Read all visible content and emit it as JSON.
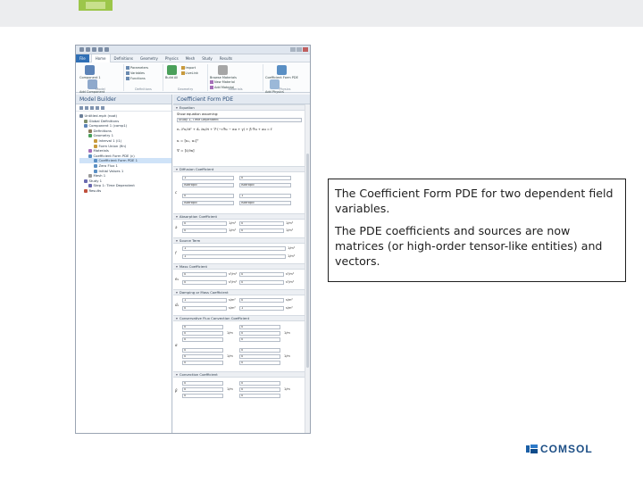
{
  "callout": {
    "paragraph1": "The Coefficient Form PDE for two dependent field variables.",
    "paragraph2": "The PDE coefficients and sources are now matrices (or high-order tensor-like entities) and vectors."
  },
  "brand": {
    "name": "COMSOL"
  },
  "app": {
    "ribbon_tabs": [
      "File",
      "Home",
      "Definitions",
      "Geometry",
      "Physics",
      "Mesh",
      "Study",
      "Results"
    ],
    "ribbon_groups": {
      "model": {
        "label": "Model",
        "buttons": [
          "Component 1",
          "Add Component"
        ]
      },
      "definitions": {
        "label": "Definitions",
        "items": [
          "Parameters",
          "Variables",
          "Functions"
        ]
      },
      "geometry": {
        "label": "Geometry",
        "items": [
          "Import",
          "LiveLink"
        ],
        "button": "Build All"
      },
      "materials": {
        "label": "Materials",
        "items": [
          "New Material",
          "Add Material"
        ],
        "button": "Browse Materials"
      },
      "physics": {
        "label": "Physics",
        "buttons": [
          "Coefficient Form PDE",
          "Add Physics"
        ]
      }
    },
    "builder": {
      "title": "Model Builder",
      "tree": [
        "Untitled.mph (root)",
        "Global Definitions",
        "Component 1 (comp1)",
        "Definitions",
        "Geometry 1",
        "Interval 1 (i1)",
        "Form Union (fin)",
        "Materials",
        "Coefficient Form PDE (c)",
        "Coefficient Form PDE 1",
        "Zero Flux 1",
        "Initial Values 1",
        "Mesh 1",
        "Study 1",
        "Step 1: Time Dependent",
        "Results"
      ]
    },
    "settings": {
      "title": "Coefficient Form PDE",
      "sections": {
        "equation": "Equation",
        "equation_label": "Show equation assuming:",
        "equation_select": "Study 1, Time Dependent",
        "eq_main": "eₐ ∂²u/∂t² + dₐ ∂u/∂t + ∇·(−c∇u − αu + γ) + β·∇u + au = f",
        "eq_u": "u = [u₁, u₂]ᵀ",
        "eq_nabla": "∇ = [∂/∂x]",
        "diffusion": "Diffusion Coefficient",
        "absorption": "Absorption Coefficient",
        "source": "Source Term",
        "mass": "Mass Coefficient",
        "damping": "Damping or Mass Coefficient",
        "conservative_flux": "Conservative Flux Convection Coefficient",
        "convection": "Convection Coefficient"
      },
      "symbols": {
        "c": "c",
        "a": "a",
        "f": "f",
        "ea": "eₐ",
        "da": "dₐ",
        "alpha": "α",
        "beta": "β"
      },
      "values": {
        "one": "1",
        "zero": "0",
        "isotropic": "Isotropic"
      },
      "units": {
        "per_m2": "1/m²",
        "per_m": "1/m",
        "s2_per_m2": "s²/m²",
        "s_per_m2": "s/m²",
        "per_m_short": "1/m"
      }
    }
  }
}
